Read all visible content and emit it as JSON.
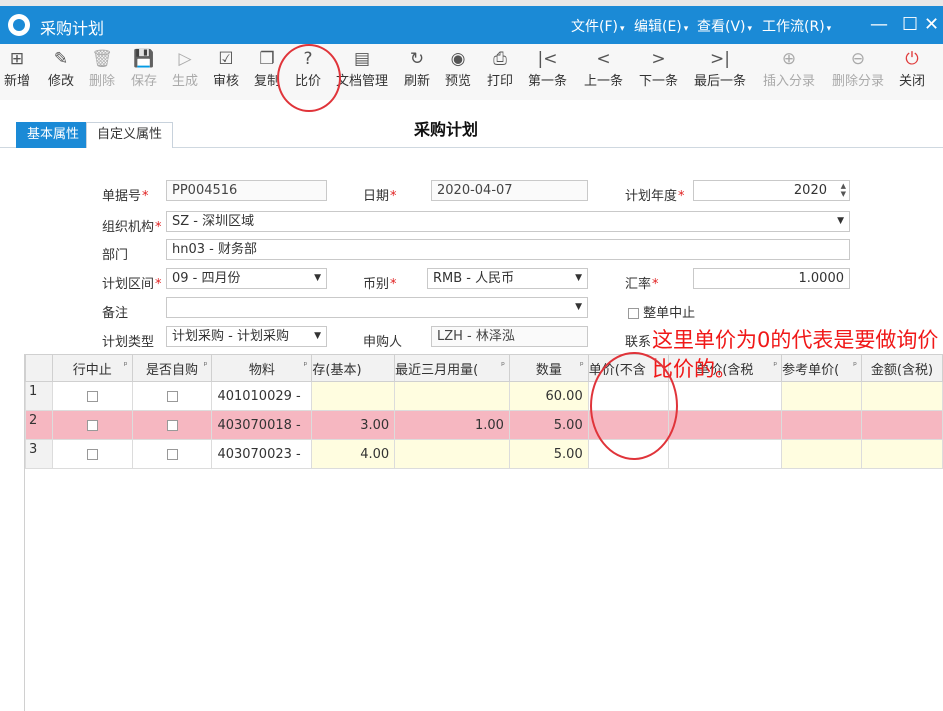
{
  "window": {
    "title": "采购计划",
    "menus": [
      "文件(F)",
      "编辑(E)",
      "查看(V)",
      "工作流(R)"
    ]
  },
  "toolbar": [
    {
      "label": "新增",
      "icon": "add-icon",
      "glyph": "⊞",
      "disabled": false
    },
    {
      "label": "修改",
      "icon": "edit-icon",
      "glyph": "✎",
      "disabled": false
    },
    {
      "label": "删除",
      "icon": "trash-icon",
      "glyph": "🗑",
      "disabled": true
    },
    {
      "label": "保存",
      "icon": "save-icon",
      "glyph": "💾",
      "disabled": true
    },
    {
      "label": "生成",
      "icon": "play-icon",
      "glyph": "▷",
      "disabled": true
    },
    {
      "label": "审核",
      "icon": "audit-icon",
      "glyph": "☑",
      "disabled": false
    },
    {
      "label": "复制",
      "icon": "copy-icon",
      "glyph": "❐",
      "disabled": false
    },
    {
      "label": "比价",
      "icon": "help-circle-icon",
      "glyph": "?",
      "disabled": false
    },
    {
      "label": "文档管理",
      "icon": "document-icon",
      "glyph": "▤",
      "disabled": false
    },
    {
      "label": "刷新",
      "icon": "refresh-icon",
      "glyph": "↻",
      "disabled": false
    },
    {
      "label": "预览",
      "icon": "eye-icon",
      "glyph": "◉",
      "disabled": false
    },
    {
      "label": "打印",
      "icon": "printer-icon",
      "glyph": "⎙",
      "disabled": false
    },
    {
      "label": "第一条",
      "icon": "first-icon",
      "glyph": "|<",
      "disabled": false
    },
    {
      "label": "上一条",
      "icon": "prev-icon",
      "glyph": "<",
      "disabled": false
    },
    {
      "label": "下一条",
      "icon": "next-icon",
      "glyph": ">",
      "disabled": false
    },
    {
      "label": "最后一条",
      "icon": "last-icon",
      "glyph": ">|",
      "disabled": false
    },
    {
      "label": "插入分录",
      "icon": "plus-circle-icon",
      "glyph": "⊕",
      "disabled": true
    },
    {
      "label": "删除分录",
      "icon": "minus-circle-icon",
      "glyph": "⊖",
      "disabled": true
    },
    {
      "label": "关闭",
      "icon": "power-icon",
      "glyph": "⏻",
      "disabled": false
    }
  ],
  "tabs": [
    "基本属性",
    "自定义属性"
  ],
  "form": {
    "title": "采购计划",
    "doc_no_label": "单据号",
    "doc_no": "PP004516",
    "date_label": "日期",
    "date": "2020-04-07",
    "plan_year_label": "计划年度",
    "plan_year": "2020",
    "org_label": "组织机构",
    "org": "SZ - 深圳区域",
    "dept_label": "部门",
    "dept": "hn03 - 财务部",
    "period_label": "计划区间",
    "period": "09 - 四月份",
    "currency_label": "币别",
    "currency": "RMB - 人民币",
    "rate_label": "汇率",
    "rate": "1.0000",
    "remark_label": "备注",
    "remark": "",
    "suspend_label": "整单中止",
    "plan_type_label": "计划类型",
    "plan_type": "计划采购 - 计划采购",
    "buyer_label": "申购人",
    "buyer": "LZH - 林泽泓",
    "contact_label": "联系"
  },
  "grid": {
    "columns": [
      "行中止",
      "是否自购",
      "物料",
      "存(基本)",
      "最近三月用量(",
      "数量",
      "单价(不含",
      "单价(含税",
      "参考单价(",
      "金额(含税)"
    ],
    "rows": [
      {
        "idx": "1",
        "material": "401010029 -",
        "stock": "",
        "usage": "",
        "qty": "60.00"
      },
      {
        "idx": "2",
        "material": "403070018 -",
        "stock": "3.00",
        "usage": "1.00",
        "qty": "5.00"
      },
      {
        "idx": "3",
        "material": "403070023 -",
        "stock": "4.00",
        "usage": "",
        "qty": "5.00"
      }
    ]
  },
  "annotation": {
    "text": "这里单价为0的代表是要做询价比价的。"
  }
}
